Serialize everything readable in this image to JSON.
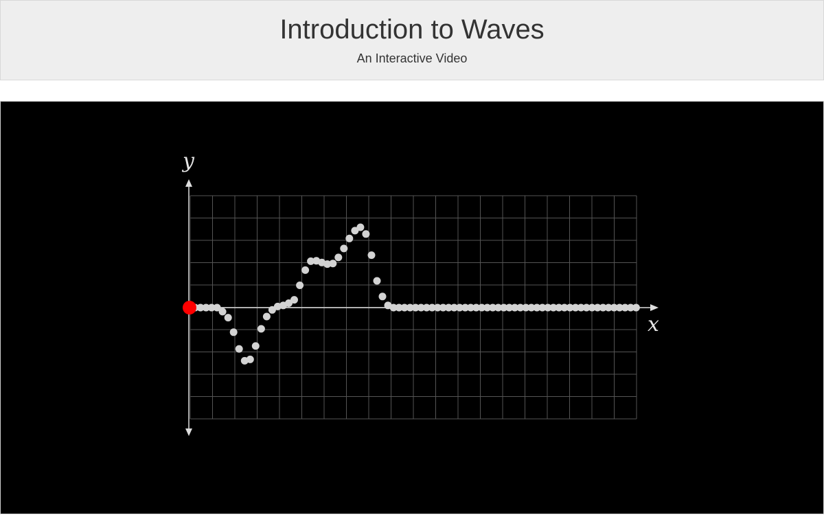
{
  "header": {
    "title": "Introduction to Waves",
    "subtitle": "An Interactive Video"
  },
  "video": {
    "background": "#000000",
    "grid_color": "#555555",
    "axis_color": "#dddddd",
    "particle_color": "#d3d3d3",
    "marker_color": "#ff0000",
    "x_axis_label": "x",
    "y_axis_label": "y",
    "grid": {
      "columns": 20,
      "rows": 10
    },
    "particle_displacements": [
      0,
      0,
      0,
      0,
      0,
      -0.18,
      -0.45,
      -1.1,
      -1.85,
      -2.38,
      -2.32,
      -1.72,
      -0.95,
      -0.4,
      -0.1,
      0.05,
      0.1,
      0.2,
      0.35,
      1.0,
      1.68,
      2.08,
      2.1,
      2.02,
      1.95,
      1.98,
      2.25,
      2.65,
      3.1,
      3.45,
      3.6,
      3.3,
      2.35,
      1.2,
      0.5,
      0.1,
      0,
      0,
      0,
      0,
      0,
      0,
      0,
      0,
      0,
      0,
      0,
      0,
      0,
      0,
      0,
      0,
      0,
      0,
      0,
      0,
      0,
      0,
      0,
      0,
      0,
      0,
      0,
      0,
      0,
      0,
      0,
      0,
      0,
      0,
      0,
      0,
      0,
      0,
      0,
      0,
      0,
      0,
      0,
      0,
      0
    ]
  }
}
